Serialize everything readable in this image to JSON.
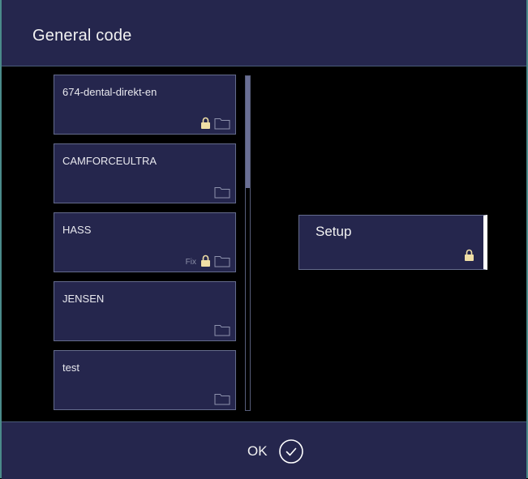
{
  "dialog": {
    "title": "General code"
  },
  "codes": [
    {
      "label": "674-dental-direkt-en",
      "fix": "",
      "locked": true
    },
    {
      "label": "CAMFORCEULTRA",
      "fix": "",
      "locked": false
    },
    {
      "label": "HASS",
      "fix": "Fix",
      "locked": true
    },
    {
      "label": "JENSEN",
      "fix": "",
      "locked": false
    },
    {
      "label": "test",
      "fix": "",
      "locked": false
    }
  ],
  "setup": {
    "label": "Setup",
    "locked": true
  },
  "footer": {
    "ok_label": "OK"
  },
  "colors": {
    "panel": "#25264d",
    "lock": "#f0dfa6",
    "folder_outline": "#8e92ad",
    "scroll_thumb": "#6a6f94"
  },
  "icons": {
    "lock": "lock-icon",
    "folder": "folder-icon",
    "confirm": "check-circle-icon"
  }
}
